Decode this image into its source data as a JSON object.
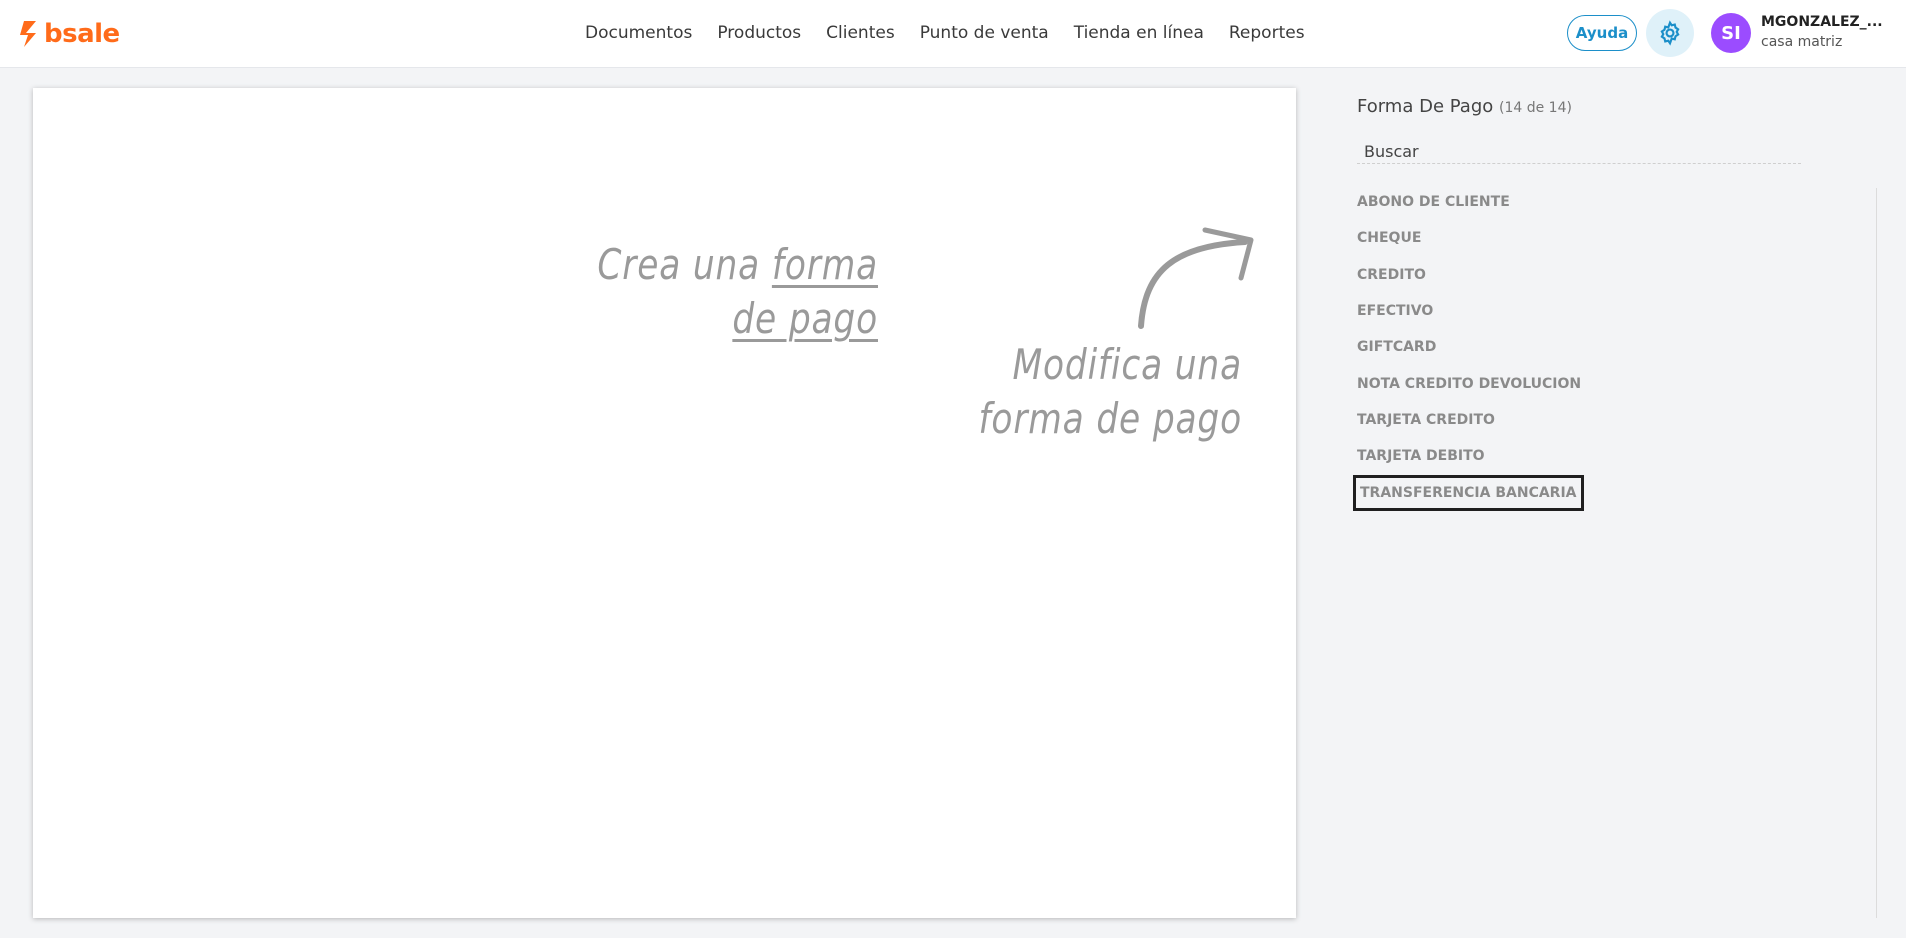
{
  "brand": {
    "name": "bsale",
    "color": "#ff6b1a"
  },
  "nav": [
    "Documentos",
    "Productos",
    "Clientes",
    "Punto de venta",
    "Tienda en línea",
    "Reportes"
  ],
  "header": {
    "help_label": "Ayuda",
    "settings_icon": "gear-icon",
    "avatar_initials": "SI",
    "user_name": "MGONZALEZ_...",
    "branch": "casa matriz"
  },
  "canvas": {
    "create_prefix": "Crea una ",
    "create_link_1": "forma",
    "create_link_2": "de pago",
    "modify_line1": "Modifica una",
    "modify_line2": "forma de pago"
  },
  "panel": {
    "title": "Forma De Pago",
    "count": "(14 de 14)",
    "search_placeholder": "Buscar",
    "items": [
      {
        "label": "ABONO DE CLIENTE"
      },
      {
        "label": "CHEQUE"
      },
      {
        "label": "CREDITO"
      },
      {
        "label": "EFECTIVO"
      },
      {
        "label": "GIFTCARD"
      },
      {
        "label": "NOTA CREDITO DEVOLUCION"
      },
      {
        "label": "TARJETA CREDITO"
      },
      {
        "label": "TARJETA DEBITO"
      },
      {
        "label": "TRANSFERENCIA BANCARIA"
      }
    ],
    "selected_index": 8
  },
  "colors": {
    "accent": "#1c8fc9",
    "avatar": "#9b4cff",
    "hint_text": "#9a9a9a"
  }
}
